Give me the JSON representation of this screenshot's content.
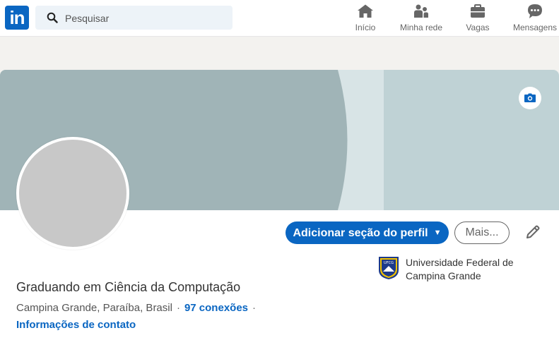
{
  "nav": {
    "logo_text": "in",
    "search": {
      "placeholder": "Pesquisar",
      "value": ""
    },
    "items": [
      {
        "label": "Início",
        "icon": "home-icon"
      },
      {
        "label": "Minha rede",
        "icon": "network-icon"
      },
      {
        "label": "Vagas",
        "icon": "briefcase-icon"
      },
      {
        "label": "Mensagens",
        "icon": "messaging-icon"
      }
    ]
  },
  "colors": {
    "brand": "#0a66c2",
    "cover_left": "#a0b4b7",
    "cover_middle": "#d8e4e6",
    "cover_right": "#bfd2d5",
    "page_bg": "#f3f2ef"
  },
  "profile": {
    "headline": "Graduando em Ciência da Computação",
    "location": "Campina Grande, Paraíba, Brasil",
    "separator": "·",
    "connections": "97 conexões",
    "contact_info": "Informações de contato",
    "add_section_button": "Adicionar seção do perfil",
    "more_button": "Mais...",
    "education": {
      "name": "Universidade Federal de Campina Grande",
      "logo_text": "UFCG"
    }
  }
}
